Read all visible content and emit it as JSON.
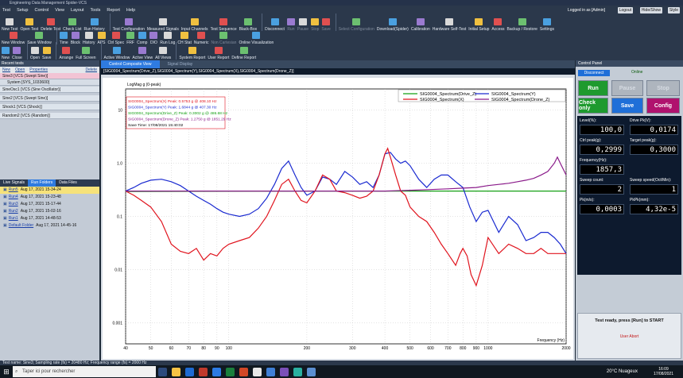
{
  "title": "Engineering Data Management Spider-VCS",
  "menu": [
    "Test",
    "Setup",
    "Control",
    "View",
    "Layout",
    "Tools",
    "Report",
    "Help"
  ],
  "logged_in": "Logged in as [Admin]",
  "top_buttons": [
    "Logout",
    "Hide/Show",
    "Style"
  ],
  "toolbar1": [
    "New Test",
    "Open Test",
    "Delete Test",
    "Check List",
    "Run History",
    "Test Configuration",
    "Measured Signals",
    "Input Channels",
    "Test Sequence",
    "Black-Box",
    "Disconnect",
    "Run",
    "Pause",
    "Stop",
    "Save",
    "Select Configuration",
    "Download(Spider)",
    "Calibration",
    "Hardware Self-Test",
    "Initial Setup",
    "Access",
    "Backup / Restore",
    "Settings"
  ],
  "toolbar2": [
    "New Window",
    "Save Window",
    "Time",
    "Block",
    "History",
    "APS",
    "Ctrl Spec",
    "FRF",
    "Comp",
    "DIO",
    "Run Log",
    "CH Stat",
    "Numeric",
    "Non Cartesian",
    "Online Visualization"
  ],
  "toolbar3": [
    "New",
    "Close",
    "Open",
    "Save",
    "Arrange",
    "Full Screen",
    "Active Window",
    "Active View",
    "All Views",
    "System Report",
    "User Report",
    "Define Report"
  ],
  "left": {
    "header": "Recent tests",
    "tabs": [
      "New",
      "Open",
      "Properties",
      "Delete"
    ],
    "tests": [
      "Sine3   [VCS (Swept Sine)]",
      "System [SYS_1033600]",
      "SineOsc1  [VCS (Sine Oscillator)]",
      "Sine2   [VCS (Swept Sine)]",
      "Shock1  [VCS (Shock)]",
      "Random2   [VCS (Random)]"
    ],
    "bottom_tabs": [
      "Live Signals",
      "Run Folders",
      "Data Files"
    ],
    "runs": [
      {
        "name": "Run5",
        "date": "Aug 17, 2021 15-34-24"
      },
      {
        "name": "Run4",
        "date": "Aug 17, 2021 15-23-48"
      },
      {
        "name": "Run3",
        "date": "Aug 17, 2021 15-17-44"
      },
      {
        "name": "Run2",
        "date": "Aug 17, 2021 15-02-16"
      },
      {
        "name": "Run1",
        "date": "Aug 17, 2021 14-48-53"
      },
      {
        "name": "Default Folder",
        "date": "Aug 17, 2021 14-45-16"
      }
    ]
  },
  "center": {
    "tabs": [
      "Control Composite View",
      "Signal Display"
    ],
    "path": "[SIG0004_Spectrum(Drive_Z),SIG0004_Spectrum(Y),SIG0004_Spectrum(X),SIG0004_Spectrum(Drone_Z)]"
  },
  "chart_data": {
    "type": "line",
    "ylabel": "LogMag g (0-peak)",
    "xlabel": "Frequency (Hz)",
    "xscale": "log",
    "yscale": "log",
    "xlim": [
      40,
      2000
    ],
    "ylim": [
      0.0004,
      25
    ],
    "xticks": [
      40,
      50,
      60,
      70,
      80,
      90,
      100,
      200,
      300,
      400,
      500,
      600,
      700,
      800,
      900,
      1000,
      2000
    ],
    "yticks": [
      10,
      1.0,
      0.1,
      0.01,
      0.001
    ],
    "ytick_labels": [
      "10",
      "1.0",
      "0.1",
      "0.01",
      "0.001"
    ],
    "annotations": [
      {
        "text": "SIG0004_Spectrum(X) Peak: 0.5753 g @ 408.10 Hz",
        "color": "#e0141e"
      },
      {
        "text": "SIG0004_Spectrum(Y) Peak: 1.6844 g @ 407.30 Hz",
        "color": "#1a2ad0"
      },
      {
        "text": "SIG0004_Spectrum(Drive_Z) Peak: 0.3002 g @ 486.68 Hz",
        "color": "#14a014"
      },
      {
        "text": "SIG0004_Spectrum(Drone_Z) Peak: 1.2750 g @ 1851.29 Hz",
        "color": "#8a1a8a"
      },
      {
        "text": "Save Time: 17/08/2021 15:40:02",
        "color": "#000000"
      }
    ],
    "legend": "top-right",
    "series": [
      {
        "name": "SIG0004_Spectrum(Drive_Z)",
        "color": "#14a014",
        "x": [
          40,
          100,
          200,
          300,
          400,
          500,
          1000,
          1500,
          2000
        ],
        "y": [
          0.295,
          0.298,
          0.3,
          0.3,
          0.3,
          0.3,
          0.3,
          0.3,
          0.3
        ]
      },
      {
        "name": "SIG0004_Spectrum(Y)",
        "color": "#1a2ad0",
        "x": [
          40,
          43,
          46,
          50,
          55,
          60,
          65,
          70,
          75,
          80,
          85,
          90,
          95,
          100,
          110,
          120,
          130,
          140,
          150,
          160,
          170,
          180,
          190,
          200,
          215,
          230,
          245,
          260,
          280,
          300,
          320,
          340,
          360,
          380,
          400,
          420,
          440,
          460,
          480,
          500,
          540,
          580,
          620,
          660,
          700,
          750,
          800,
          850,
          900,
          950,
          1000,
          1100,
          1200,
          1300,
          1400,
          1500,
          1600,
          1700,
          1800,
          1900,
          2000
        ],
        "y": [
          0.3,
          0.35,
          0.42,
          0.48,
          0.5,
          0.45,
          0.38,
          0.3,
          0.24,
          0.2,
          0.17,
          0.14,
          0.12,
          0.11,
          0.1,
          0.11,
          0.14,
          0.22,
          0.4,
          0.8,
          1.1,
          0.6,
          0.35,
          0.25,
          0.3,
          0.55,
          0.5,
          0.4,
          0.7,
          0.55,
          0.4,
          0.45,
          0.35,
          0.6,
          1.5,
          1.6,
          1.2,
          1.0,
          1.1,
          0.9,
          0.5,
          0.35,
          0.5,
          0.6,
          0.6,
          0.45,
          0.35,
          0.15,
          0.08,
          0.12,
          0.13,
          0.05,
          0.1,
          0.07,
          0.035,
          0.04,
          0.05,
          0.05,
          0.04,
          0.03,
          0.02
        ]
      },
      {
        "name": "SIG0004_Spectrum(X)",
        "color": "#e0141e",
        "x": [
          40,
          43,
          46,
          50,
          55,
          60,
          65,
          70,
          75,
          80,
          85,
          90,
          95,
          100,
          110,
          120,
          130,
          140,
          150,
          160,
          170,
          180,
          190,
          200,
          215,
          230,
          245,
          260,
          280,
          300,
          320,
          340,
          360,
          380,
          400,
          410,
          420,
          440,
          460,
          480,
          500,
          540,
          580,
          620,
          660,
          700,
          750,
          780,
          800,
          830,
          860,
          900,
          950,
          1000,
          1100,
          1200,
          1300,
          1400,
          1500,
          1600,
          1700,
          1800,
          1900,
          2000
        ],
        "y": [
          0.3,
          0.25,
          0.2,
          0.15,
          0.08,
          0.03,
          0.022,
          0.02,
          0.025,
          0.015,
          0.02,
          0.018,
          0.025,
          0.03,
          0.035,
          0.04,
          0.06,
          0.1,
          0.2,
          0.4,
          0.5,
          0.3,
          0.2,
          0.18,
          0.3,
          0.6,
          0.5,
          0.3,
          0.28,
          0.25,
          0.22,
          0.24,
          0.3,
          0.6,
          1.5,
          1.9,
          1.3,
          0.6,
          0.3,
          0.25,
          0.15,
          0.1,
          0.08,
          0.05,
          0.03,
          0.02,
          0.012,
          0.02,
          0.025,
          0.018,
          0.008,
          0.005,
          0.012,
          0.04,
          0.02,
          0.03,
          0.025,
          0.02,
          0.02,
          0.025,
          0.02,
          0.02,
          0.02,
          0.02
        ]
      },
      {
        "name": "SIG0004_Spectrum(Drone_Z)",
        "color": "#8a1a8a",
        "x": [
          40,
          100,
          200,
          300,
          400,
          500,
          600,
          700,
          800,
          900,
          1000,
          1100,
          1200,
          1300,
          1400,
          1500,
          1600,
          1700,
          1800,
          1850,
          1900,
          2000
        ],
        "y": [
          0.3,
          0.3,
          0.3,
          0.3,
          0.3,
          0.31,
          0.32,
          0.33,
          0.34,
          0.35,
          0.38,
          0.4,
          0.42,
          0.45,
          0.48,
          0.52,
          0.6,
          0.7,
          1.0,
          1.3,
          1.0,
          0.6
        ]
      }
    ]
  },
  "right": {
    "header": "Control Panel",
    "disconnect": "Disconnect",
    "online": "Online",
    "run": "Run",
    "pause": "Pause",
    "stop": "Stop",
    "check_only": "Check only",
    "save": "Save",
    "config": "Config",
    "labels": [
      "Level(%):",
      "Drive Pk(V):",
      "Ctrl peak(g):",
      "Target peak(g):",
      "Frequency(Hz):",
      "Sweep count:",
      "Sweep speed(Oct/Min):",
      "Pk(m/s):",
      "PkPk(mm):"
    ],
    "values": [
      "100,0",
      "0,0174",
      "0,2999",
      "0,3000",
      "1857,3",
      "2",
      "1",
      "0,0003",
      "4,32e-5"
    ],
    "message": "Test ready, press [Run] to START",
    "abort": "User Abort"
  },
  "status": "Test name: Sine3; Sampling rate (fs) = 20480 Hz; Frequency range (fs) = 2000 Hz",
  "taskbar": {
    "search": "Taper ici pour rechercher",
    "weather": "20°C  Nuageux",
    "time": "16:09",
    "date": "17/08/2021"
  }
}
